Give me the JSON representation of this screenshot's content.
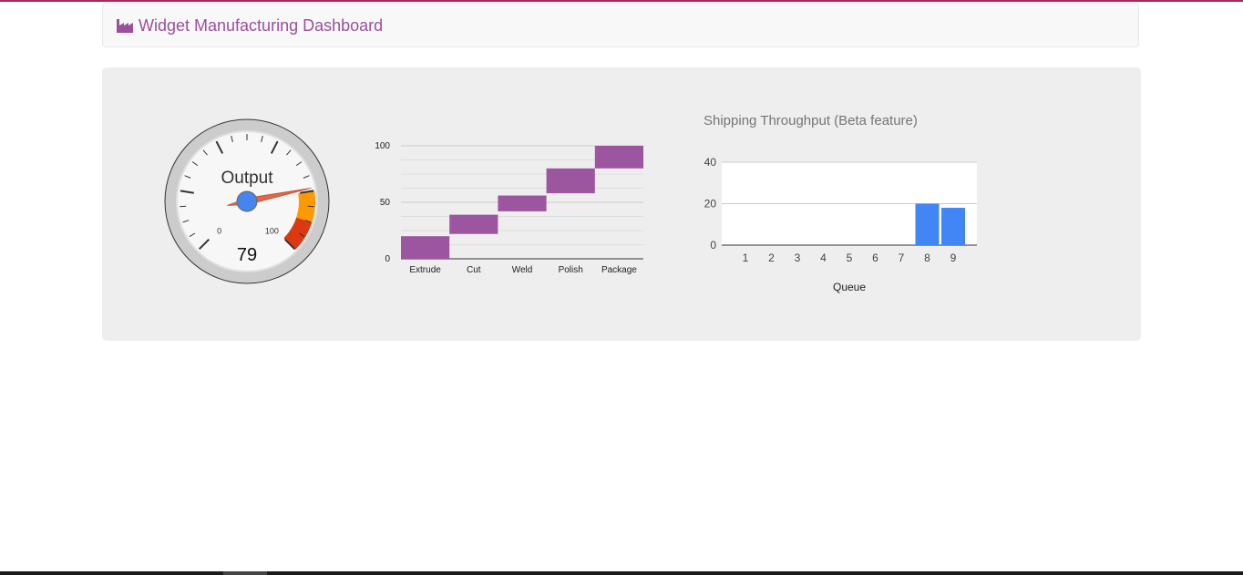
{
  "header": {
    "title": "Widget Manufacturing Dashboard",
    "icon": "factory-icon",
    "brand_color": "#9c4f9c"
  },
  "chart_data": [
    {
      "type": "gauge",
      "label": "Output",
      "value": 79,
      "min": 0,
      "max": 100,
      "tick_labels": [
        "0",
        "100"
      ],
      "yellow_band": [
        80,
        90
      ],
      "red_band": [
        90,
        100
      ],
      "needle_color": "#e06848",
      "colors": {
        "yellow": "#ff9900",
        "red": "#dc3912"
      }
    },
    {
      "type": "bar",
      "subtype": "waterfall",
      "categories": [
        "Extrude",
        "Cut",
        "Weld",
        "Polish",
        "Package"
      ],
      "ranges": [
        [
          0,
          20
        ],
        [
          22,
          39
        ],
        [
          42,
          56
        ],
        [
          58,
          80
        ],
        [
          80,
          100
        ]
      ],
      "ylim": [
        0,
        100
      ],
      "yticks": [
        "0",
        "50",
        "100"
      ],
      "color": "#9c56a0"
    },
    {
      "type": "bar",
      "title": "Shipping Throughput (Beta feature)",
      "xlabel": "Queue",
      "categories": [
        "1",
        "2",
        "3",
        "4",
        "5",
        "6",
        "7",
        "8",
        "9"
      ],
      "values": [
        0,
        0,
        0,
        0,
        0,
        0,
        0,
        20,
        18
      ],
      "ylim": [
        0,
        40
      ],
      "yticks": [
        "0",
        "20",
        "40"
      ],
      "color": "#4285f4"
    }
  ]
}
